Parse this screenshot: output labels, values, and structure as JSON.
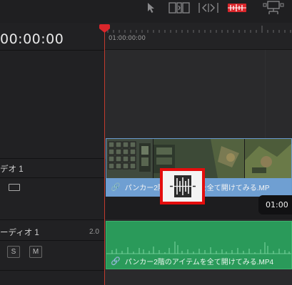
{
  "toolbar": {
    "icons": [
      "pointer-icon",
      "trim-edit-icon",
      "dynamic-trim-icon",
      "blade-icon",
      "dropdown-tool-icon"
    ],
    "active_color": "#d9262b"
  },
  "timecode": "00:00:00",
  "ruler": {
    "start_label": "01:00:00:00"
  },
  "tracks": {
    "video": {
      "name": "デオ 1"
    },
    "audio": {
      "name": "ーディオ 1",
      "level": "2.0",
      "solo_label": "S",
      "mute_label": "M"
    }
  },
  "clips": {
    "video_label": "パンカー2階のアイテムを全て開けてみる.MP",
    "audio_label": "パンカー2階のアイテムを全て開けてみる.MP4"
  },
  "tooltip": {
    "timecode": "01:00"
  },
  "colors": {
    "video_clip": "#6f9fd2",
    "audio_clip": "#2a9a5a",
    "playhead": "#c23b2e",
    "highlight": "#e40d0d"
  }
}
